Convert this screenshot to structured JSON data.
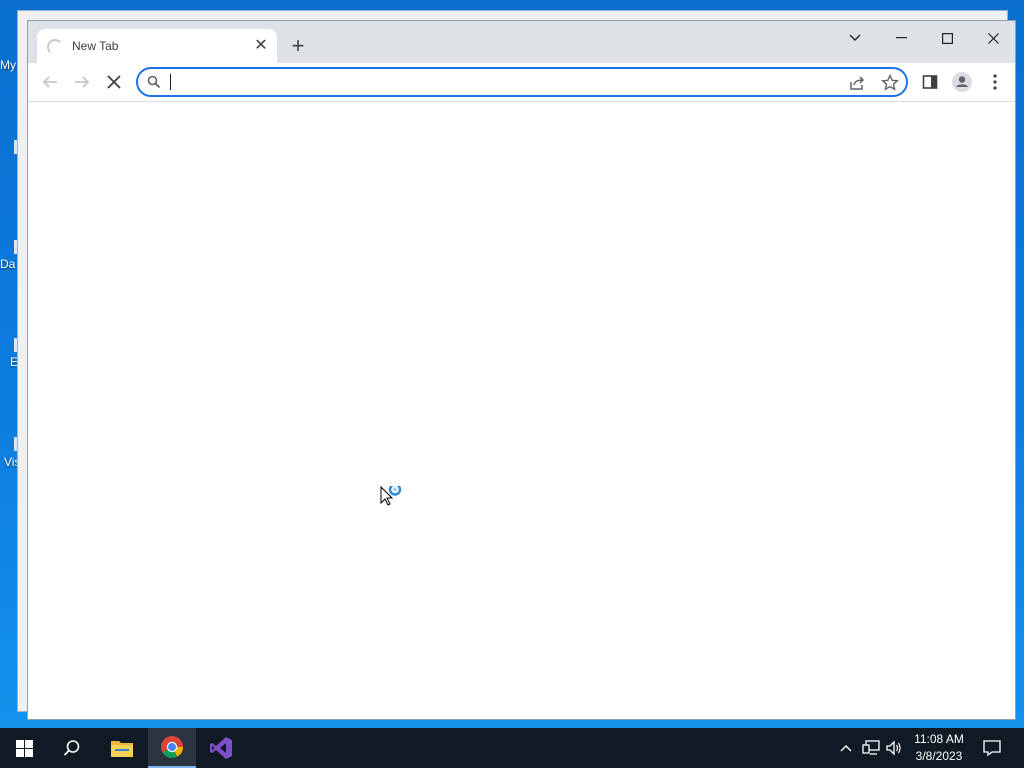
{
  "desktop": {
    "labels": [
      "My",
      "Da",
      "E",
      "Vis"
    ]
  },
  "browser": {
    "tab": {
      "title": "New Tab",
      "close_glyph": "✕"
    },
    "new_tab_glyph": "+",
    "address_bar": {
      "value": "",
      "placeholder": ""
    },
    "toolbar_icons": [
      "back-icon",
      "forward-icon",
      "stop-icon",
      "search-icon",
      "share-icon",
      "star-icon",
      "side-panel-icon",
      "profile-icon",
      "menu-icon"
    ],
    "window_controls": [
      "tab-search-icon",
      "minimize-icon",
      "maximize-icon",
      "close-icon"
    ]
  },
  "taskbar": {
    "apps": [
      "start-icon",
      "search-icon",
      "file-explorer-icon",
      "chrome-icon",
      "visual-studio-icon"
    ],
    "clock": {
      "time": "11:08 AM",
      "date": "3/8/2023"
    }
  },
  "colors": {
    "accent": "#1a73e8",
    "taskbar": "#101a24",
    "desktop": "#0c7ee0"
  }
}
